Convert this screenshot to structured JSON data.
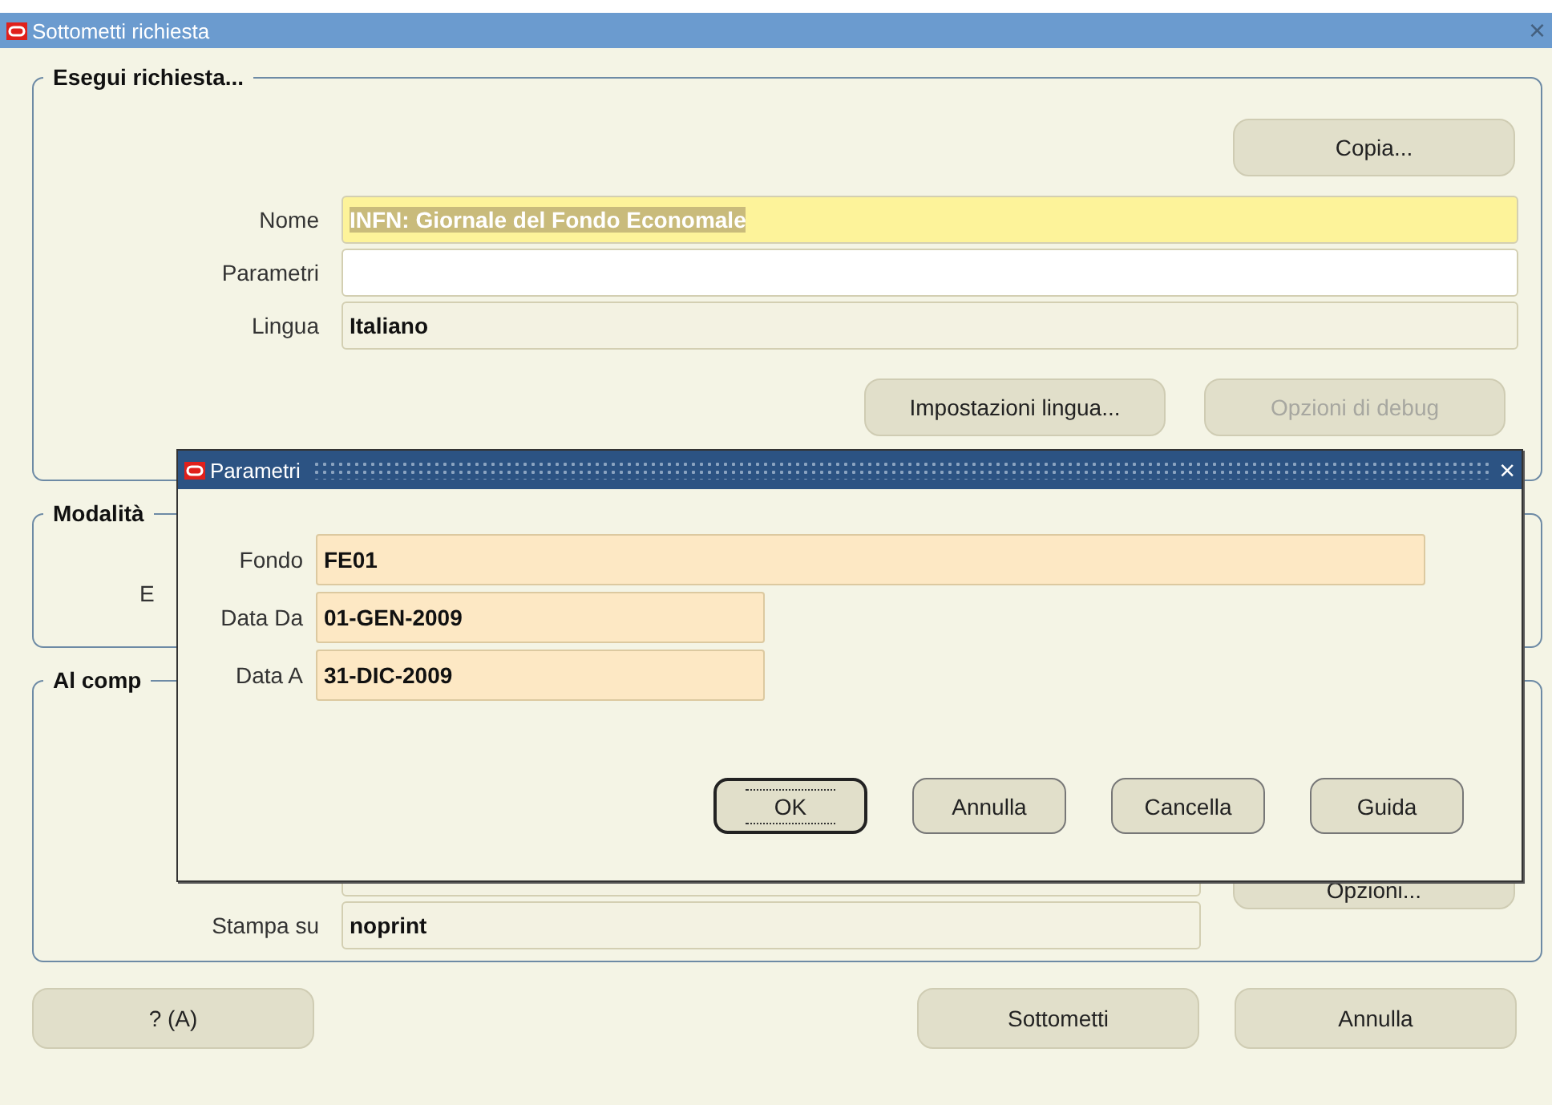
{
  "window": {
    "title": "Sottometti richiesta",
    "close": "×"
  },
  "run_section": {
    "title": "Esegui richiesta...",
    "copy_button": "Copia...",
    "fields": [
      {
        "label": "Nome",
        "value": "INFN: Giornale del Fondo Economale",
        "kind": "selected"
      },
      {
        "label": "Parametri",
        "kind": "editable"
      },
      {
        "label": "Lingua",
        "value": "Italiano",
        "kind": "readonly"
      }
    ],
    "buttons": [
      {
        "label": "Impostazioni lingua...",
        "disabled": false
      },
      {
        "label": "Opzioni di debug",
        "disabled": true
      }
    ]
  },
  "mode_section": {
    "title": "Modalità",
    "field_label": "E"
  },
  "completion_section": {
    "title": "Al comp",
    "options_button": "Opzioni...",
    "fields": [
      {
        "label": "Stampa su",
        "value": "noprint"
      }
    ]
  },
  "footer_buttons": [
    {
      "label": "? (A)"
    },
    {
      "label": "Sottometti"
    },
    {
      "label": "Annulla"
    }
  ],
  "dialog": {
    "title": "Parametri",
    "close": "×",
    "fields": [
      {
        "label": "Fondo",
        "value": "FE01",
        "kind": "wide"
      },
      {
        "label": "Data Da",
        "value": "01-GEN-2009",
        "kind": "narrow"
      },
      {
        "label": "Data A",
        "value": "31-DIC-2009",
        "kind": "narrow"
      }
    ],
    "buttons": [
      {
        "label": "OK",
        "default": true
      },
      {
        "label": "Annulla",
        "default": false
      },
      {
        "label": "Cancella",
        "default": false
      },
      {
        "label": "Guida",
        "default": false
      }
    ]
  }
}
